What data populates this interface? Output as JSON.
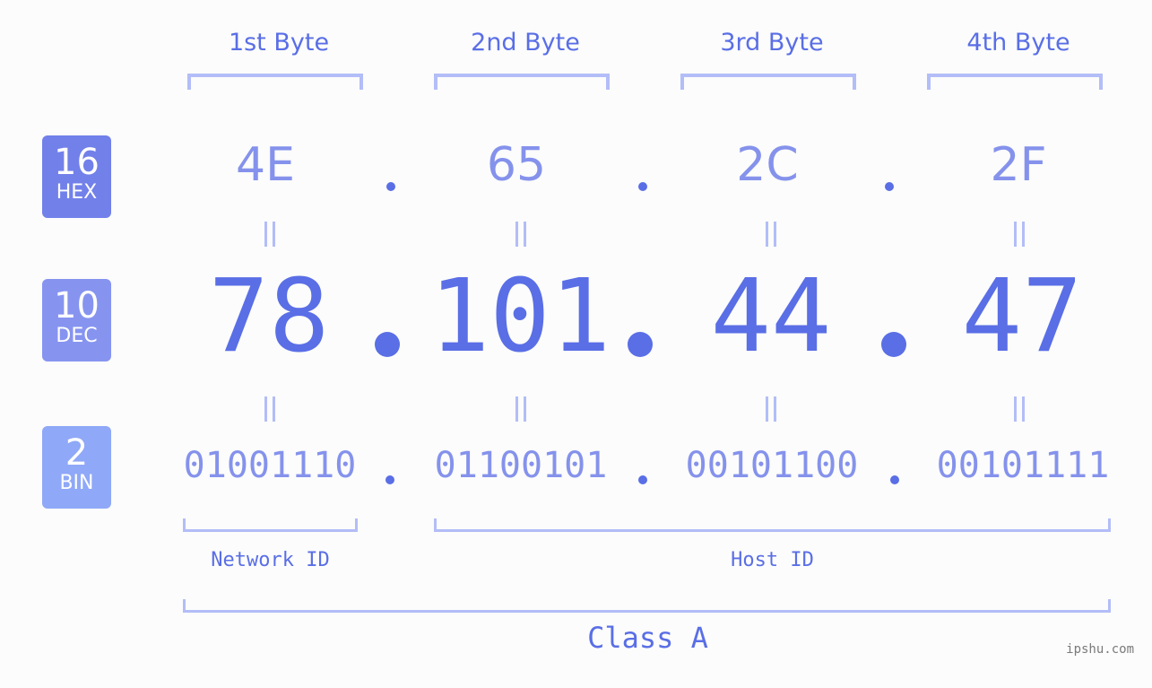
{
  "bytes": [
    {
      "label": "1st Byte",
      "hex": "4E",
      "dec": "78",
      "bin": "01001110"
    },
    {
      "label": "2nd Byte",
      "hex": "65",
      "dec": "101",
      "bin": "01100101"
    },
    {
      "label": "3rd Byte",
      "hex": "2C",
      "dec": "44",
      "bin": "00101100"
    },
    {
      "label": "4th Byte",
      "hex": "2F",
      "dec": "47",
      "bin": "00101111"
    }
  ],
  "badges": {
    "hex": {
      "num": "16",
      "label": "HEX",
      "color": "#7280ea"
    },
    "dec": {
      "num": "10",
      "label": "DEC",
      "color": "#8694f0"
    },
    "bin": {
      "num": "2",
      "label": "BIN",
      "color": "#8fa8f7"
    }
  },
  "ids": {
    "network": "Network ID",
    "host": "Host ID"
  },
  "class_label": "Class A",
  "watermark": "ipshu.com",
  "colors": {
    "primary": "#5a6ee6",
    "light": "#8592ec",
    "bracket": "#b3bdf7"
  }
}
